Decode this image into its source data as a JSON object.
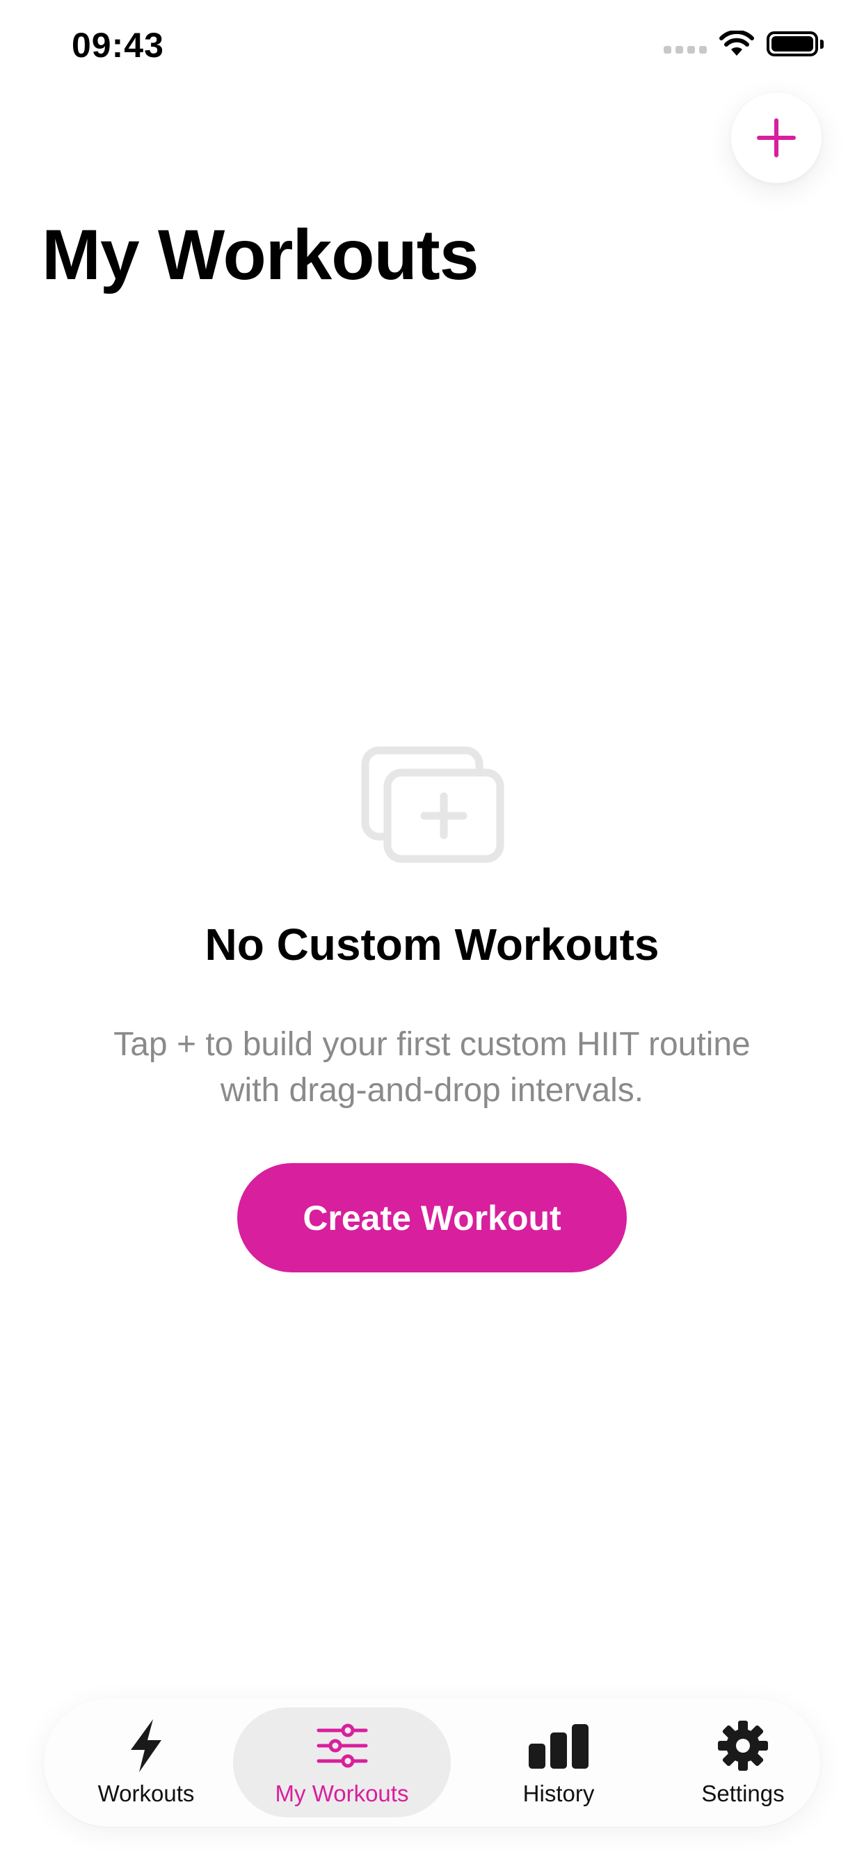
{
  "status_bar": {
    "time": "09:43"
  },
  "header": {
    "title": "My Workouts",
    "add_icon": "plus-icon"
  },
  "empty_state": {
    "icon": "stack-plus-icon",
    "title": "No Custom Workouts",
    "description": "Tap + to build your first custom HIIT routine with drag-and-drop intervals.",
    "button_label": "Create Workout"
  },
  "tab_bar": {
    "items": [
      {
        "label": "Workouts",
        "icon": "bolt-icon",
        "active": false
      },
      {
        "label": "My Workouts",
        "icon": "sliders-icon",
        "active": true
      },
      {
        "label": "History",
        "icon": "bar-chart-icon",
        "active": false
      },
      {
        "label": "Settings",
        "icon": "gear-icon",
        "active": false
      }
    ]
  },
  "colors": {
    "accent": "#d81f9d",
    "muted_text": "#8a8a8a",
    "illustration": "#e6e6e6",
    "active_tab_bg": "#ececec"
  }
}
